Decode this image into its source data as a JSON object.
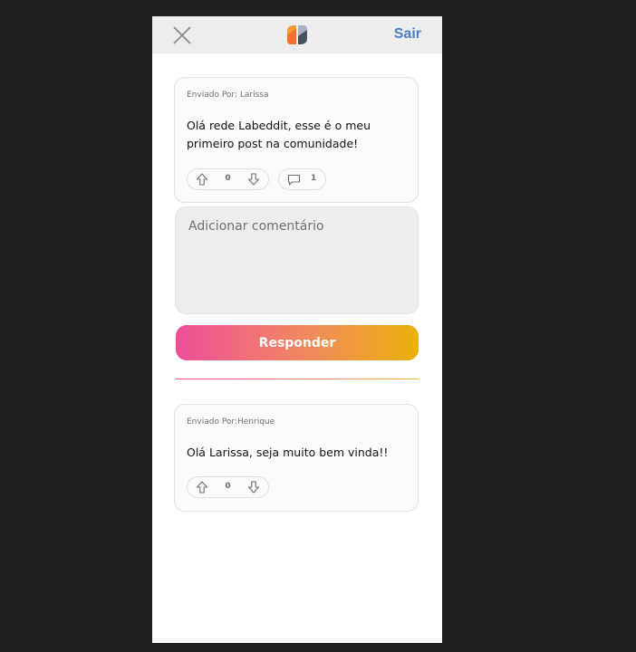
{
  "header": {
    "close_icon": "close-x-icon",
    "logo_icon": "labeddit-logo",
    "logout_label": "Sair"
  },
  "post": {
    "author": "Enviado Por: Larissa",
    "text": "Olá rede Labeddit, esse é o meu primeiro post na comunidade!",
    "votes": "0",
    "comments": "1"
  },
  "comment_form": {
    "placeholder": "Adicionar comentário",
    "value": "",
    "submit_label": "Responder"
  },
  "comments": [
    {
      "author": "Enviado Por:Henrique",
      "text": "Olá Larissa, seja muito bem vinda!!",
      "votes": "0"
    }
  ],
  "colors": {
    "background": "#202022",
    "header": "#ededed",
    "logout": "#4a7fc1",
    "gradient_start": "#ef4e9a",
    "gradient_end": "#ebb10b"
  }
}
